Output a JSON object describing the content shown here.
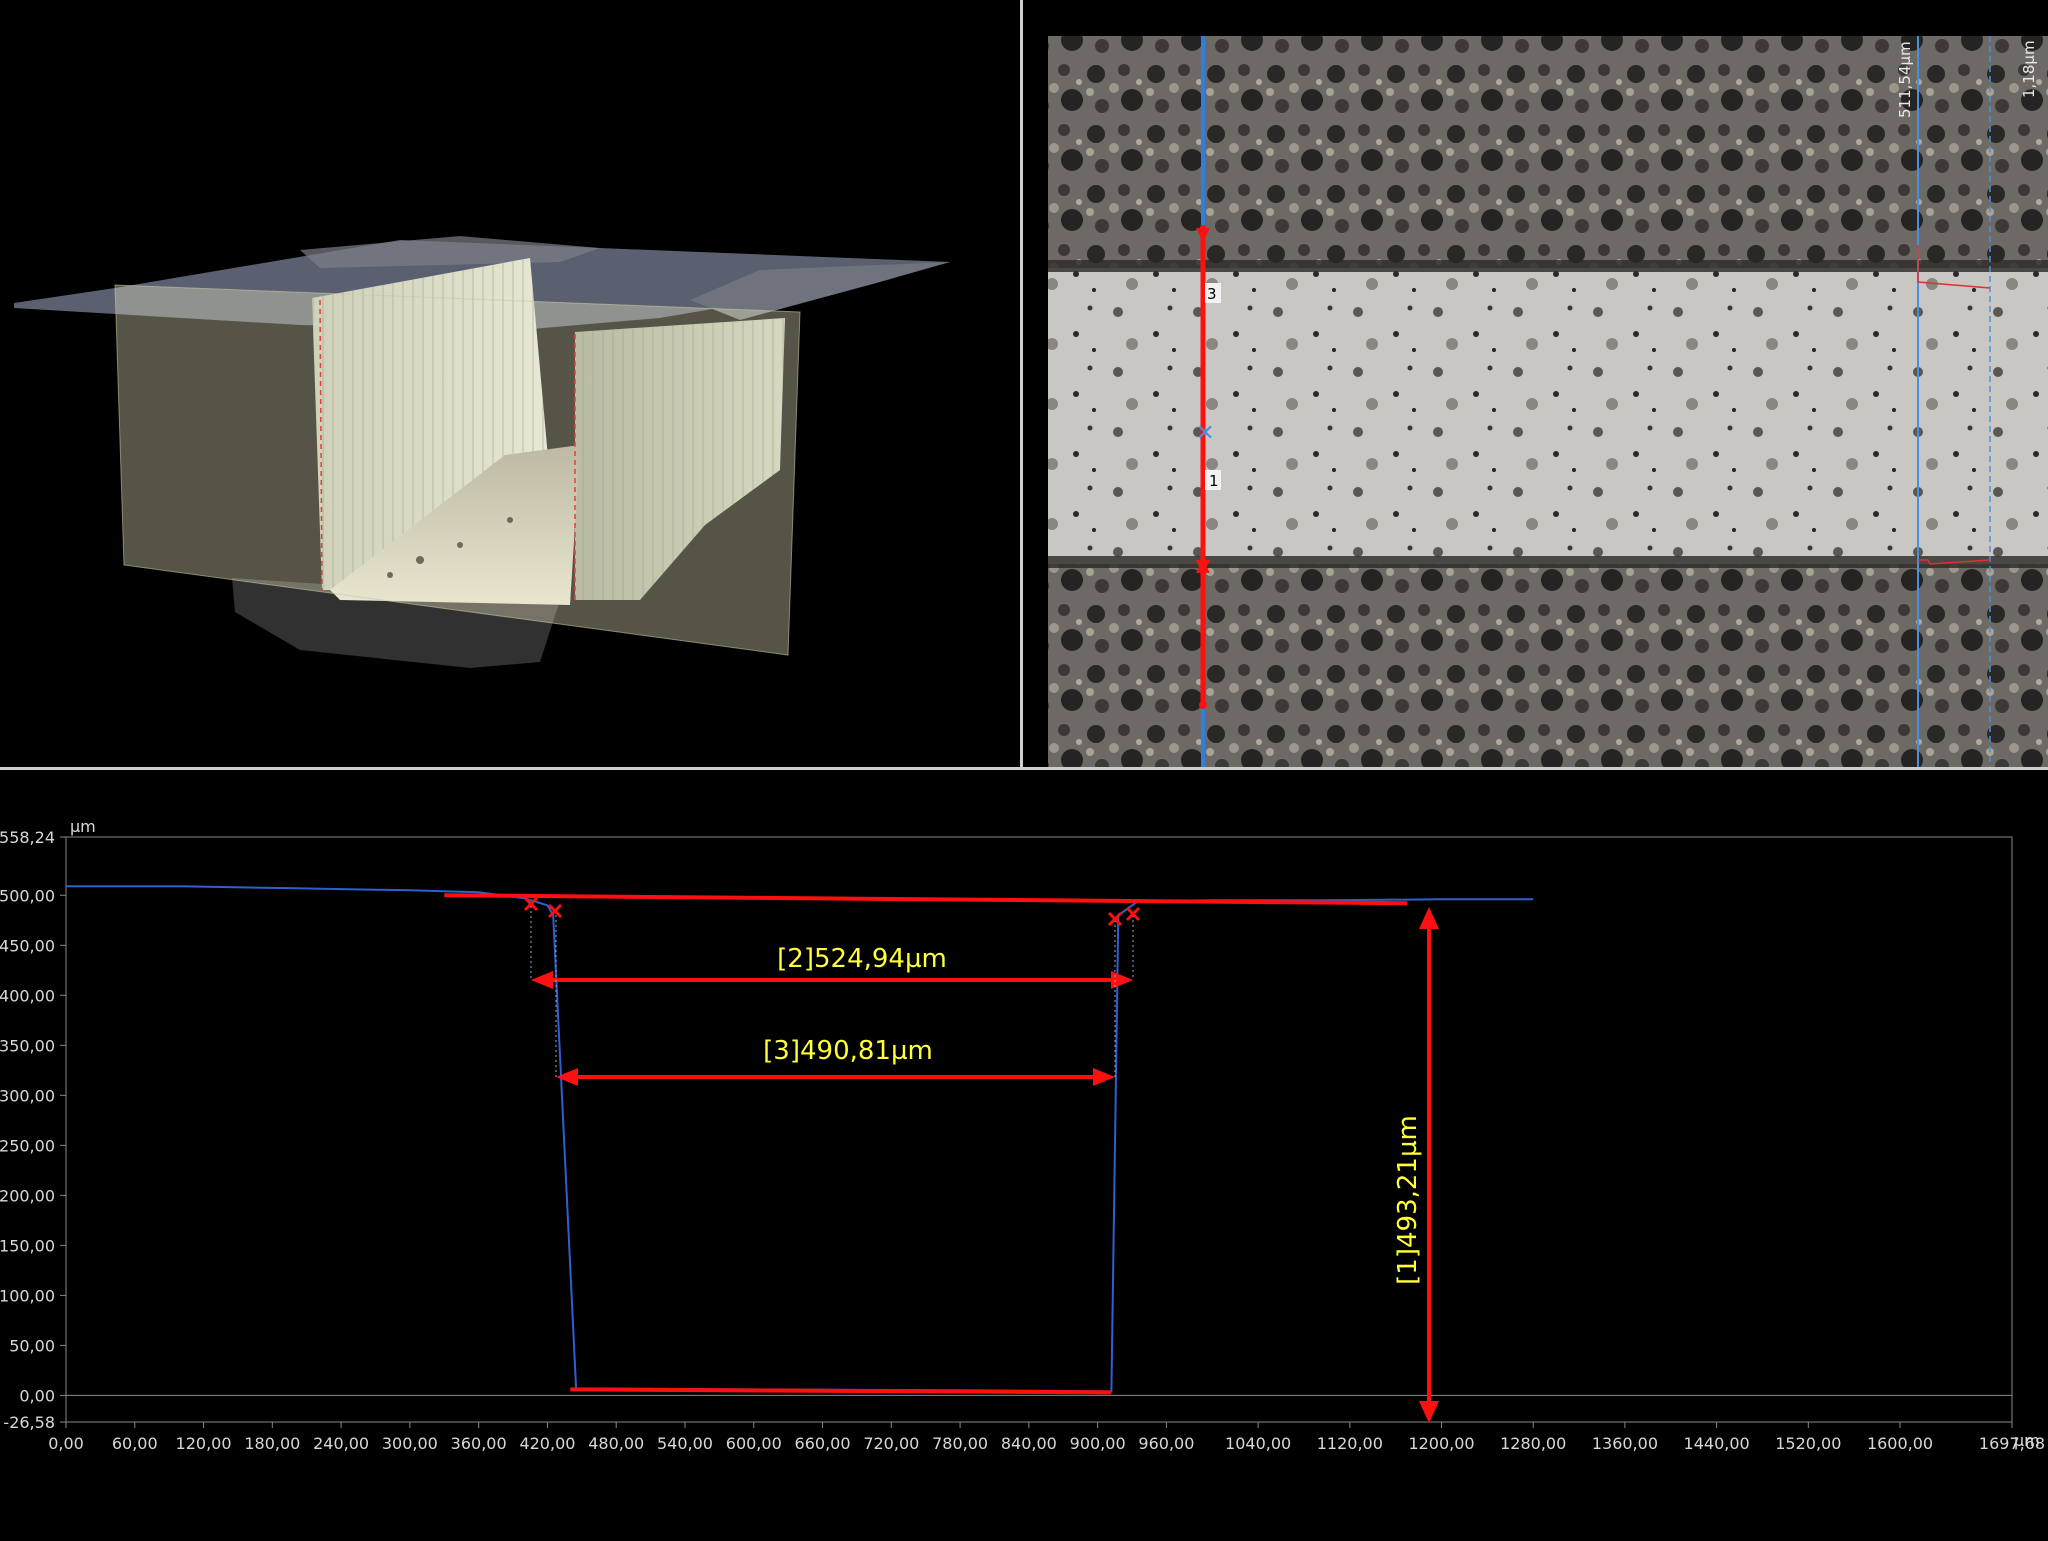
{
  "micrograph": {
    "marker_labels": [
      "3",
      "1"
    ],
    "side_labels": [
      "511,54µm",
      "1,18µm"
    ]
  },
  "profile": {
    "y_unit": "µm",
    "x_unit": "µm",
    "y_ticks": [
      "558,24",
      "500,00",
      "450,00",
      "400,00",
      "350,00",
      "300,00",
      "250,00",
      "200,00",
      "150,00",
      "100,00",
      "50,00",
      "0,00",
      "-26,58"
    ],
    "x_ticks": [
      "0,00",
      "60,00",
      "120,00",
      "180,00",
      "240,00",
      "300,00",
      "360,00",
      "420,00",
      "480,00",
      "540,00",
      "600,00",
      "660,00",
      "720,00",
      "780,00",
      "840,00",
      "900,00",
      "960,00",
      "1040,00",
      "1120,00",
      "1200,00",
      "1280,00",
      "1360,00",
      "1440,00",
      "1520,00",
      "1600,00",
      "1697,68"
    ],
    "measurements": {
      "m1": "[1]493,21µm",
      "m2": "[2]524,94µm",
      "m3": "[3]490,81µm"
    },
    "colors": {
      "profile_line": "#2f5fd0",
      "measure": "#ff1010",
      "label": "#ffff3a"
    }
  },
  "chart_data": {
    "type": "line",
    "xlabel": "µm",
    "ylabel": "µm",
    "xlim": [
      0,
      1697.68
    ],
    "ylim": [
      -26.58,
      558.24
    ],
    "series": [
      {
        "x": [
          0,
          100,
          200,
          300,
          360,
          400,
          420,
          425,
          445,
          600,
          800,
          912,
          918,
          935,
          1000,
          1100,
          1200,
          1280
        ],
        "y": [
          509,
          509,
          507,
          505,
          503,
          497,
          490,
          480,
          7,
          6,
          5,
          4,
          480,
          494,
          495,
          495,
          496,
          496
        ]
      }
    ]
  }
}
